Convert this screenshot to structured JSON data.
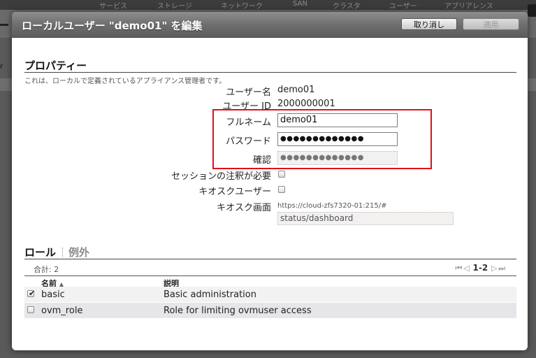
{
  "background": {
    "nav_items": [
      "サービス",
      "ストレージ",
      "ネットワーク",
      "SAN",
      "クラスタ",
      "ユーザー",
      "アプリアレンス"
    ]
  },
  "dialog": {
    "title": "ローカルユーザー \"demo01\" を編集",
    "cancel_label": "取り消し",
    "apply_label": "適用"
  },
  "properties": {
    "heading": "プロパティー",
    "note": "これは、ローカルで定義されているアプライアンス管理者です。",
    "username_label": "ユーザー名",
    "username_value": "demo01",
    "userid_label": "ユーザー ID",
    "userid_value": "2000000001",
    "fullname_label": "フルネーム",
    "fullname_value": "demo01",
    "password_label": "パスワード",
    "password_value": "●●●●●●●●●●●●●",
    "confirm_label": "確認",
    "confirm_value": "●●●●●●●●●●●●●",
    "session_note_label": "セッションの注釈が必要",
    "session_note_checked": false,
    "kiosk_user_label": "キオスクユーザー",
    "kiosk_user_checked": false,
    "kiosk_screen_label": "キオスク画面",
    "kiosk_url_prefix": "https://cloud-zfs7320-01:215/#",
    "kiosk_screen_value": "status/dashboard"
  },
  "roles": {
    "tab_active": "ロール",
    "tab_other": "例外",
    "total": "合計: 2",
    "page_range": "1-2",
    "columns": {
      "name": "名前",
      "name_sort_icon": "▲",
      "description": "説明"
    },
    "rows": [
      {
        "checked": true,
        "name": "basic",
        "description": "Basic administration"
      },
      {
        "checked": false,
        "name": "ovm_role",
        "description": "Role for limiting ovmuser access"
      }
    ]
  },
  "colors": {
    "highlight": "#e0101a",
    "titlebar": "#6f6f6f"
  }
}
